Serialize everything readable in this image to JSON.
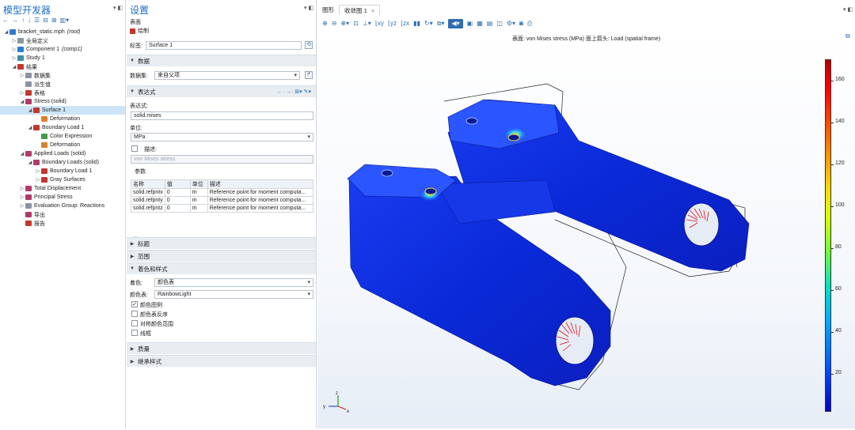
{
  "model_builder": {
    "title": "模型开发器",
    "tree": [
      {
        "label": "bracket_static.mph",
        "suffix": "(root)",
        "depth": 0,
        "icon": "file-icon",
        "twisty": "open"
      },
      {
        "label": "全局定义",
        "depth": 1,
        "icon": "globe-icon",
        "twisty": "closed"
      },
      {
        "label": "Component 1",
        "suffix": "(comp1)",
        "depth": 1,
        "icon": "component-icon",
        "twisty": "closed"
      },
      {
        "label": "Study 1",
        "depth": 1,
        "icon": "study-icon",
        "twisty": "closed"
      },
      {
        "label": "结果",
        "depth": 1,
        "icon": "results-icon",
        "twisty": "open"
      },
      {
        "label": "数据集",
        "depth": 2,
        "icon": "dataset-icon",
        "twisty": "closed"
      },
      {
        "label": "派生值",
        "depth": 2,
        "icon": "derived-values-icon",
        "twisty": ""
      },
      {
        "label": "表格",
        "depth": 2,
        "icon": "table-icon",
        "twisty": "closed"
      },
      {
        "label": "Stress (solid)",
        "depth": 2,
        "icon": "plot-group-icon",
        "twisty": "open"
      },
      {
        "label": "Surface 1",
        "depth": 3,
        "icon": "surface-icon",
        "twisty": "open",
        "selected": true
      },
      {
        "label": "Deformation",
        "depth": 4,
        "icon": "deformation-icon",
        "twisty": ""
      },
      {
        "label": "Boundary Load 1",
        "depth": 3,
        "icon": "arrow-icon",
        "twisty": "open"
      },
      {
        "label": "Color Expression",
        "depth": 4,
        "icon": "color-expression-icon",
        "twisty": ""
      },
      {
        "label": "Deformation",
        "depth": 4,
        "icon": "deformation-icon",
        "twisty": ""
      },
      {
        "label": "Applied Loads (solid)",
        "depth": 2,
        "icon": "plot-group-icon",
        "twisty": "open"
      },
      {
        "label": "Boundary Loads (solid)",
        "depth": 3,
        "icon": "plot-group-icon",
        "twisty": "open"
      },
      {
        "label": "Boundary Load 1",
        "depth": 4,
        "icon": "arrow-icon",
        "twisty": "closed"
      },
      {
        "label": "Gray Surfaces",
        "depth": 4,
        "icon": "surface-icon",
        "twisty": "closed"
      },
      {
        "label": "Total Displacement",
        "depth": 2,
        "icon": "plot-group-icon",
        "twisty": "closed"
      },
      {
        "label": "Principal Stress",
        "depth": 2,
        "icon": "plot-group-icon",
        "twisty": "closed"
      },
      {
        "label": "Evaluation Group: Reactions",
        "depth": 2,
        "icon": "evaluation-icon",
        "twisty": "closed"
      },
      {
        "label": "导出",
        "depth": 2,
        "icon": "export-icon",
        "twisty": ""
      },
      {
        "label": "报告",
        "depth": 2,
        "icon": "report-icon",
        "twisty": ""
      }
    ]
  },
  "settings": {
    "title": "设置",
    "subtitle": "表面",
    "plot_label": "绘制",
    "label_caption": "标签:",
    "label_value": "Surface 1",
    "sections": {
      "data": "数据",
      "expression": "表达式",
      "title": "标题",
      "range": "范围",
      "coloring": "着色和样式",
      "quality": "质量",
      "inherit": "继承样式"
    },
    "dataset_caption": "数据集:",
    "dataset_value": "来自父项",
    "expression_caption": "表达式:",
    "expression_value": "solid.mises",
    "unit_caption": "单位:",
    "unit_value": "MPa",
    "description_caption": "描述:",
    "description_value": "von Mises stress",
    "params_caption": "参数",
    "params_headers": [
      "名称",
      "值",
      "单位",
      "描述"
    ],
    "params_rows": [
      {
        "name": "solid.refpntx",
        "value": "0",
        "unit": "m",
        "desc": "Reference point for moment computa..."
      },
      {
        "name": "solid.refpnty",
        "value": "0",
        "unit": "m",
        "desc": "Reference point for moment computa..."
      },
      {
        "name": "solid.refpntz",
        "value": "0",
        "unit": "m",
        "desc": "Reference point for moment computa..."
      }
    ],
    "coloring_caption": "着色:",
    "coloring_value": "颜色表",
    "color_table_caption": "颜色表:",
    "color_table_value": "RainbowLight",
    "checks": [
      {
        "label": "颜色图例",
        "checked": true
      },
      {
        "label": "颜色表反序",
        "checked": false
      },
      {
        "label": "对称颜色范围",
        "checked": false
      },
      {
        "label": "线框",
        "checked": false
      }
    ]
  },
  "graphics": {
    "tabs": [
      "图形",
      "收敛图 1"
    ],
    "plot_title": "表面: von Mises stress (MPa)  面上箭头: Load (spatial frame)",
    "colorbar_ticks": [
      "160",
      "140",
      "120",
      "100",
      "80",
      "60",
      "40",
      "20"
    ],
    "colorbar_range": [
      2,
      170
    ],
    "colormap": "RainbowLight",
    "axis_labels": {
      "x": "x",
      "y": "y",
      "z": "z"
    }
  }
}
